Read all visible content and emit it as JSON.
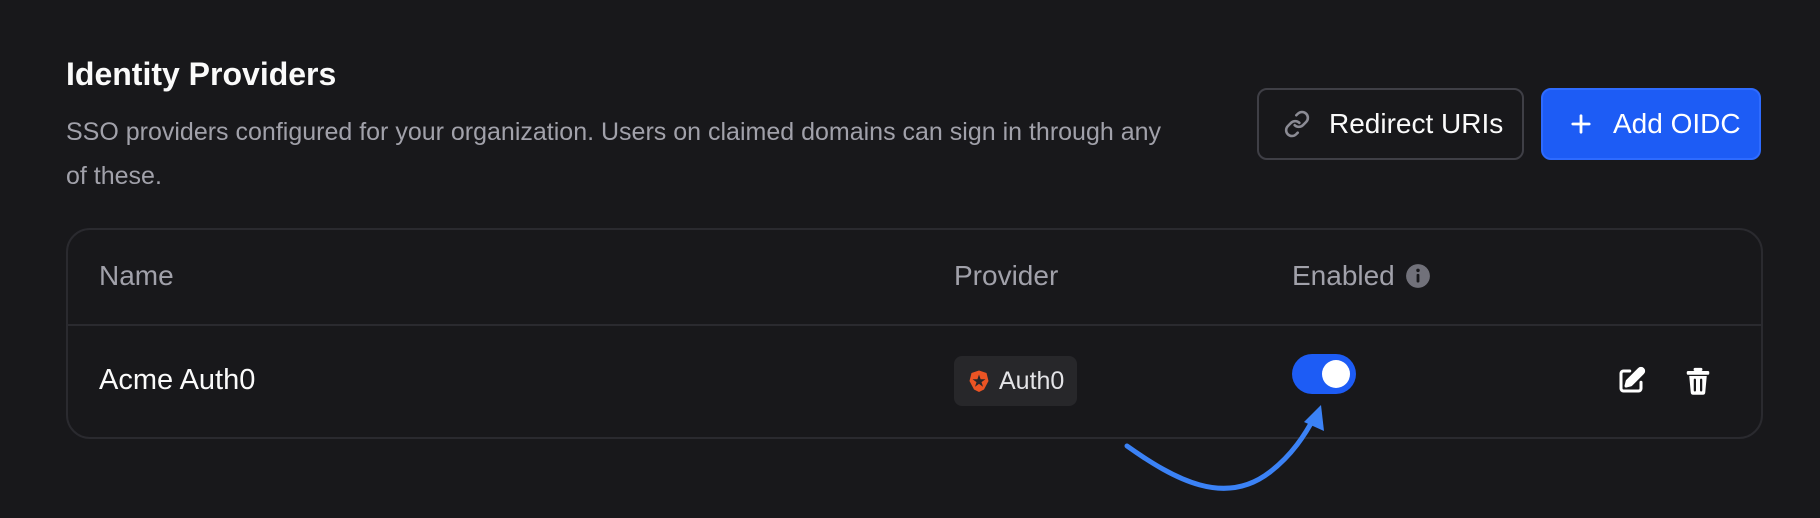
{
  "section": {
    "title": "Identity Providers",
    "description": "SSO providers configured for your organization. Users on claimed domains can sign in through any of these."
  },
  "actions": {
    "redirect_label": "Redirect URIs",
    "redirect_icon": "link-icon",
    "add_label": "Add OIDC",
    "add_icon": "plus-icon"
  },
  "table": {
    "columns": {
      "name": "Name",
      "provider": "Provider",
      "enabled": "Enabled"
    },
    "rows": [
      {
        "name": "Acme Auth0",
        "provider": "Auth0",
        "provider_icon": "auth0-logo-icon",
        "enabled": true
      }
    ]
  },
  "colors": {
    "background": "#18181b",
    "accent": "#1d5cf5",
    "muted_text": "#a1a1aa",
    "border": "#2a2a2f",
    "auth0_orange": "#eb5424",
    "annotation": "#3b82f6"
  }
}
